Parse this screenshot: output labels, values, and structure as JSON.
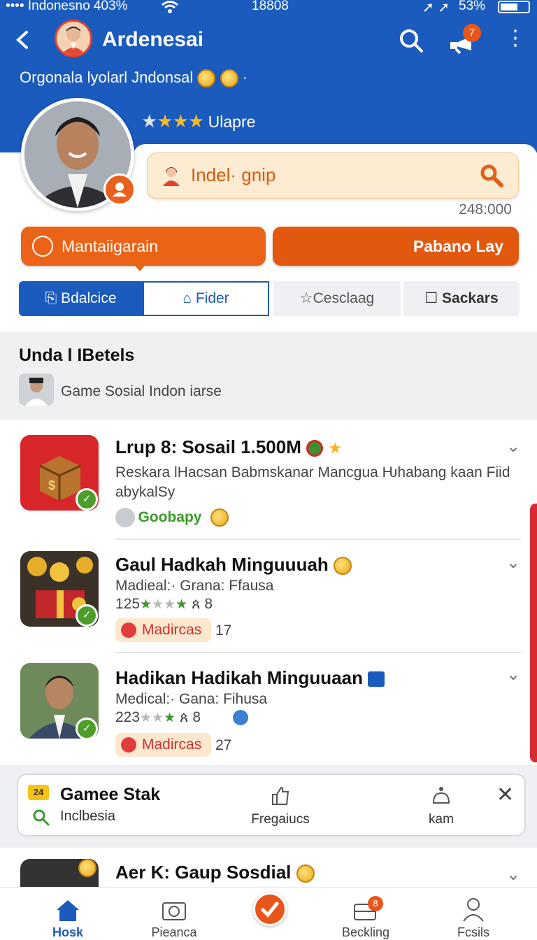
{
  "status": {
    "carrier": "•••• Indonesno 403%",
    "time": "18808",
    "battery": "53%"
  },
  "header": {
    "title": "Ardenesai",
    "notification_count": "7",
    "subtitle": "Orgonala lyolarl Jndonsal"
  },
  "profile": {
    "rating_stars": 4,
    "rating_label": "Ulapre"
  },
  "search": {
    "text": "Indel· gnip",
    "count": "248:000"
  },
  "actions": {
    "primary": "Mantaiigarain",
    "secondary": "Pabano Lay"
  },
  "tabs": [
    "Bdalcice",
    "Fider",
    "Cesclaag",
    "Sackars"
  ],
  "section": {
    "heading": "Unda l IBetels",
    "subheading": "Game Sosial Indon iarse"
  },
  "items": [
    {
      "title": "Lrup 8: Sosail 1.500M",
      "line1": "Reskara lHacsan Babmskanar Mancgua Ƕhabang kaan  Fiid",
      "line2": "abykalSy",
      "tag": "Goobapy"
    },
    {
      "title": "Gaul Hadkah Minguuuah",
      "line1": "Madieal:· Grana: Ffausa",
      "line2": "125",
      "line2b": "ጰ 8",
      "tag": "Madircas",
      "tag_count": "17"
    },
    {
      "title": "Hadikan Hadikah Minguuaan",
      "line1": "Medical:· Gana: Fihusa",
      "line2": "223",
      "line2b": "ጰ 8",
      "tag": "Madircas",
      "tag_count": "27"
    }
  ],
  "bar": {
    "badge": "24",
    "title": "Gamee Stak",
    "location": "Inclbesia",
    "col2": "Fregaiucs",
    "col3": "kam"
  },
  "peek": {
    "title": "Aer K: Gaup Sosdial"
  },
  "nav": [
    {
      "label": "Hosk",
      "icon": "home-icon"
    },
    {
      "label": "Pieanca",
      "icon": "camera-icon"
    },
    {
      "label": "",
      "icon": "check-icon"
    },
    {
      "label": "Beckling",
      "icon": "briefcase-icon",
      "badge": "8"
    },
    {
      "label": "Fcsils",
      "icon": "user-icon"
    }
  ],
  "colors": {
    "primary_blue": "#1a5bbd",
    "accent_orange": "#ea6317",
    "highlight_red": "#d72a33"
  }
}
